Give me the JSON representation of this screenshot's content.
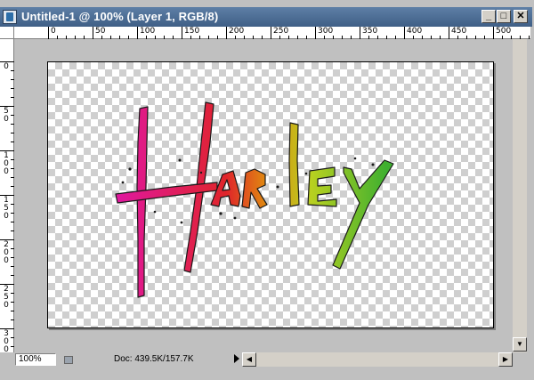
{
  "window": {
    "title": "Untitled-1 @ 100% (Layer 1, RGB/8)",
    "buttons": {
      "minimize": "_",
      "maximize": "□",
      "close": "✕"
    }
  },
  "ruler": {
    "horizontal_labels": [
      "0",
      "50",
      "100",
      "150",
      "200",
      "250",
      "300",
      "350",
      "400",
      "450",
      "500"
    ],
    "vertical_labels": [
      "0",
      "5\n0",
      "1\n0\n0",
      "1\n5\n0",
      "2\n0\n0",
      "2\n5\n0",
      "3\n0\n0"
    ]
  },
  "canvas": {
    "artwork_text": "Harley",
    "gradient_colors": [
      "#e0189c",
      "#e0242a",
      "#e08a10",
      "#b8d020",
      "#3fb030"
    ]
  },
  "status": {
    "zoom": "100%",
    "doc_info": "Doc: 439.5K/157.7K"
  }
}
